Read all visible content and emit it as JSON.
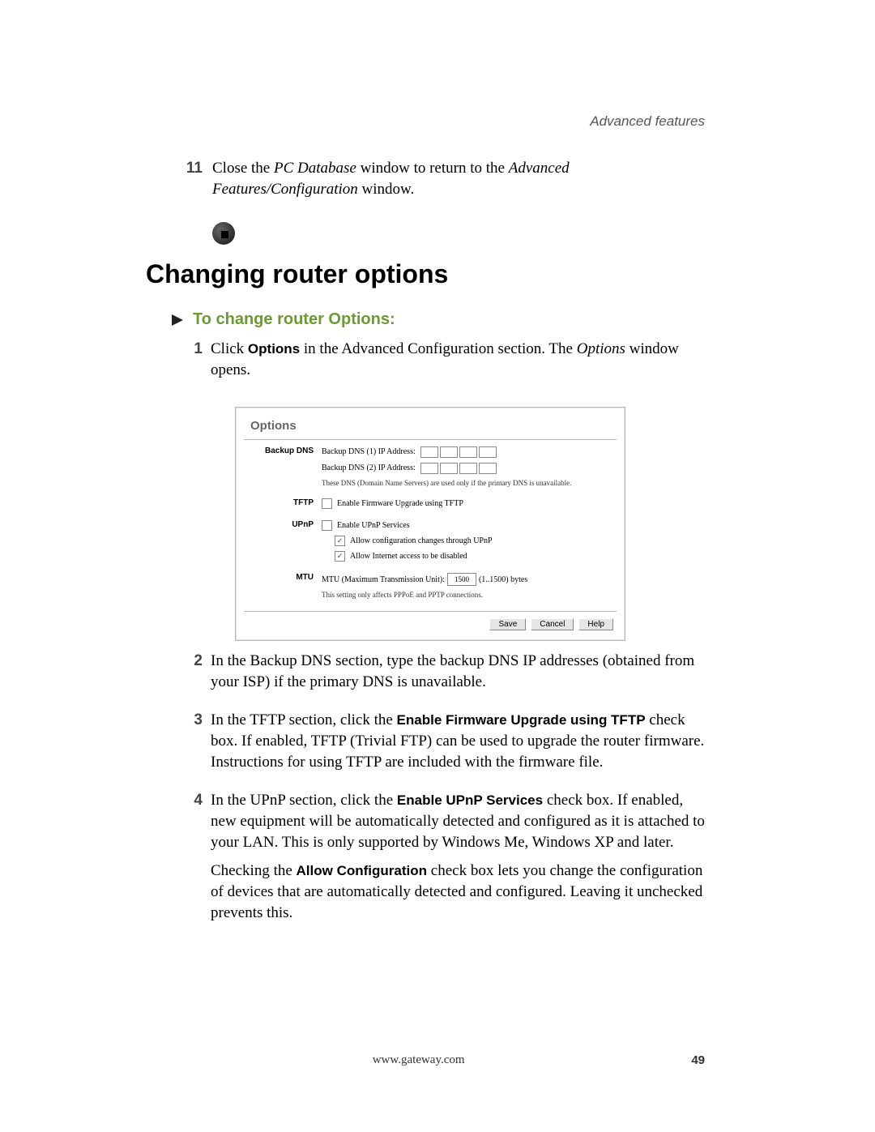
{
  "running_head": "Advanced features",
  "step11": {
    "num": "11",
    "pre": "Close the ",
    "em1": "PC Database",
    "mid": " window to return to the ",
    "em2": "Advanced Features/Configuration",
    "post": " window."
  },
  "heading": "Changing router options",
  "subheading": "To change router Options:",
  "steps": {
    "s1": {
      "n": "1",
      "a": "Click ",
      "b_bold": "Options",
      "c": " in the Advanced Configuration section. The ",
      "d_em": "Options",
      "e": " window opens."
    },
    "s2": {
      "n": "2",
      "text": "In the Backup DNS section, type the backup DNS IP addresses (obtained from your ISP) if the primary DNS is unavailable."
    },
    "s3": {
      "n": "3",
      "a": "In the TFTP section, click the ",
      "b_bold": "Enable Firmware Upgrade using TFTP",
      "c": " check box. If enabled, TFTP (Trivial FTP) can be used to upgrade the router firmware. Instructions for using TFTP are included with the firmware file."
    },
    "s4": {
      "n": "4",
      "a": "In the UPnP section, click the ",
      "b_bold": "Enable UPnP Services",
      "c": " check box. If enabled, new equipment will be automatically detected and configured as it is attached to your LAN. This is only supported by Windows Me, Windows XP and later.",
      "p2a": "Checking the ",
      "p2b_bold": "Allow Configuration",
      "p2c": " check box lets you change the configuration of devices that are automatically detected and configured. Leaving it unchecked prevents this."
    }
  },
  "panel": {
    "title": "Options",
    "rows": {
      "backup_dns": {
        "label": "Backup DNS",
        "l1": "Backup DNS (1) IP Address:",
        "l2": "Backup DNS (2) IP Address:",
        "note": "These DNS (Domain Name Servers) are used only if the primary DNS is unavailable."
      },
      "tftp": {
        "label": "TFTP",
        "l1": "Enable Firmware Upgrade using TFTP"
      },
      "upnp": {
        "label": "UPnP",
        "l1": "Enable UPnP Services",
        "l2": "Allow configuration changes through UPnP",
        "l3": "Allow Internet access to be disabled"
      },
      "mtu": {
        "label": "MTU",
        "l1a": "MTU (Maximum Transmission Unit):",
        "value": "1500",
        "l1b": "(1..1500) bytes",
        "note": "This setting only affects PPPoE and PPTP connections."
      }
    },
    "buttons": {
      "save": "Save",
      "cancel": "Cancel",
      "help": "Help"
    }
  },
  "footer": {
    "url": "www.gateway.com",
    "page": "49"
  }
}
